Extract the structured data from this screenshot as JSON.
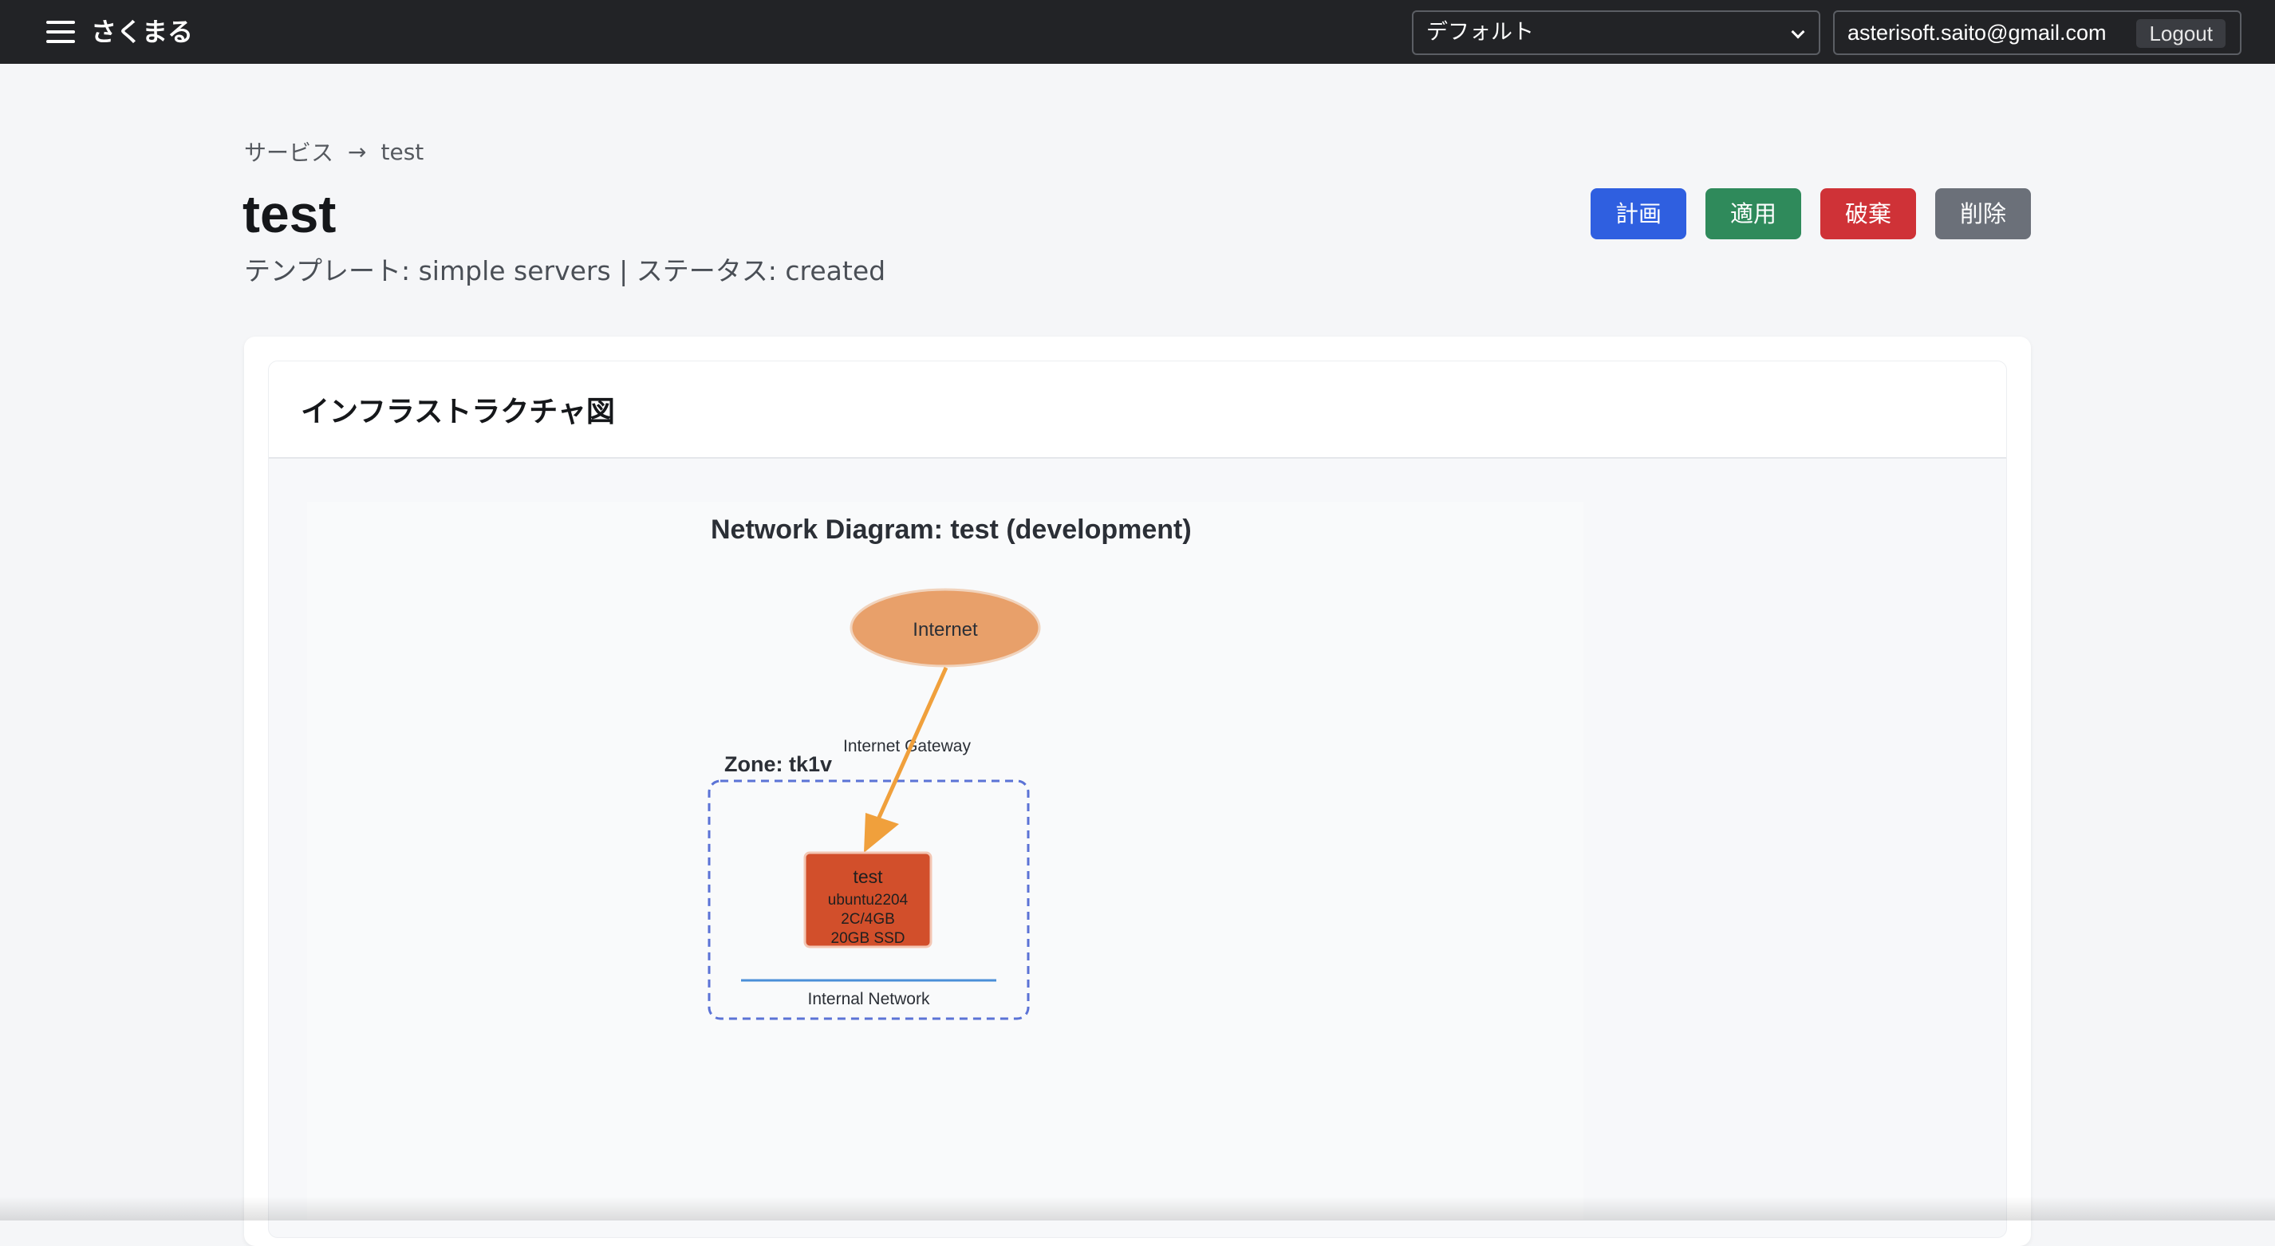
{
  "header": {
    "brand": "さくまる",
    "project_select": "デフォルト",
    "user_email": "asterisoft.saito@gmail.com",
    "logout_label": "Logout"
  },
  "breadcrumb": {
    "root": "サービス",
    "separator": "→",
    "current": "test"
  },
  "page": {
    "title": "test",
    "subtitle": "テンプレート: simple servers | ステータス: created"
  },
  "actions": {
    "plan": "計画",
    "apply": "適用",
    "destroy": "破棄",
    "delete": "削除"
  },
  "card": {
    "title": "インフラストラクチャ図"
  },
  "diagram": {
    "title": "Network Diagram: test (development)",
    "internet": "Internet",
    "gateway": "Internet Gateway",
    "zone": "Zone: tk1v",
    "server": {
      "name": "test",
      "os": "ubuntu2204",
      "spec": "2C/4GB",
      "disk": "20GB SSD"
    },
    "network": "Internal Network",
    "colors": {
      "internet": "#e8a06a",
      "server": "#d24f2b",
      "arrow": "#f0a03c",
      "zone_border": "#5b73d6",
      "network_line": "#4a8fd8"
    }
  }
}
